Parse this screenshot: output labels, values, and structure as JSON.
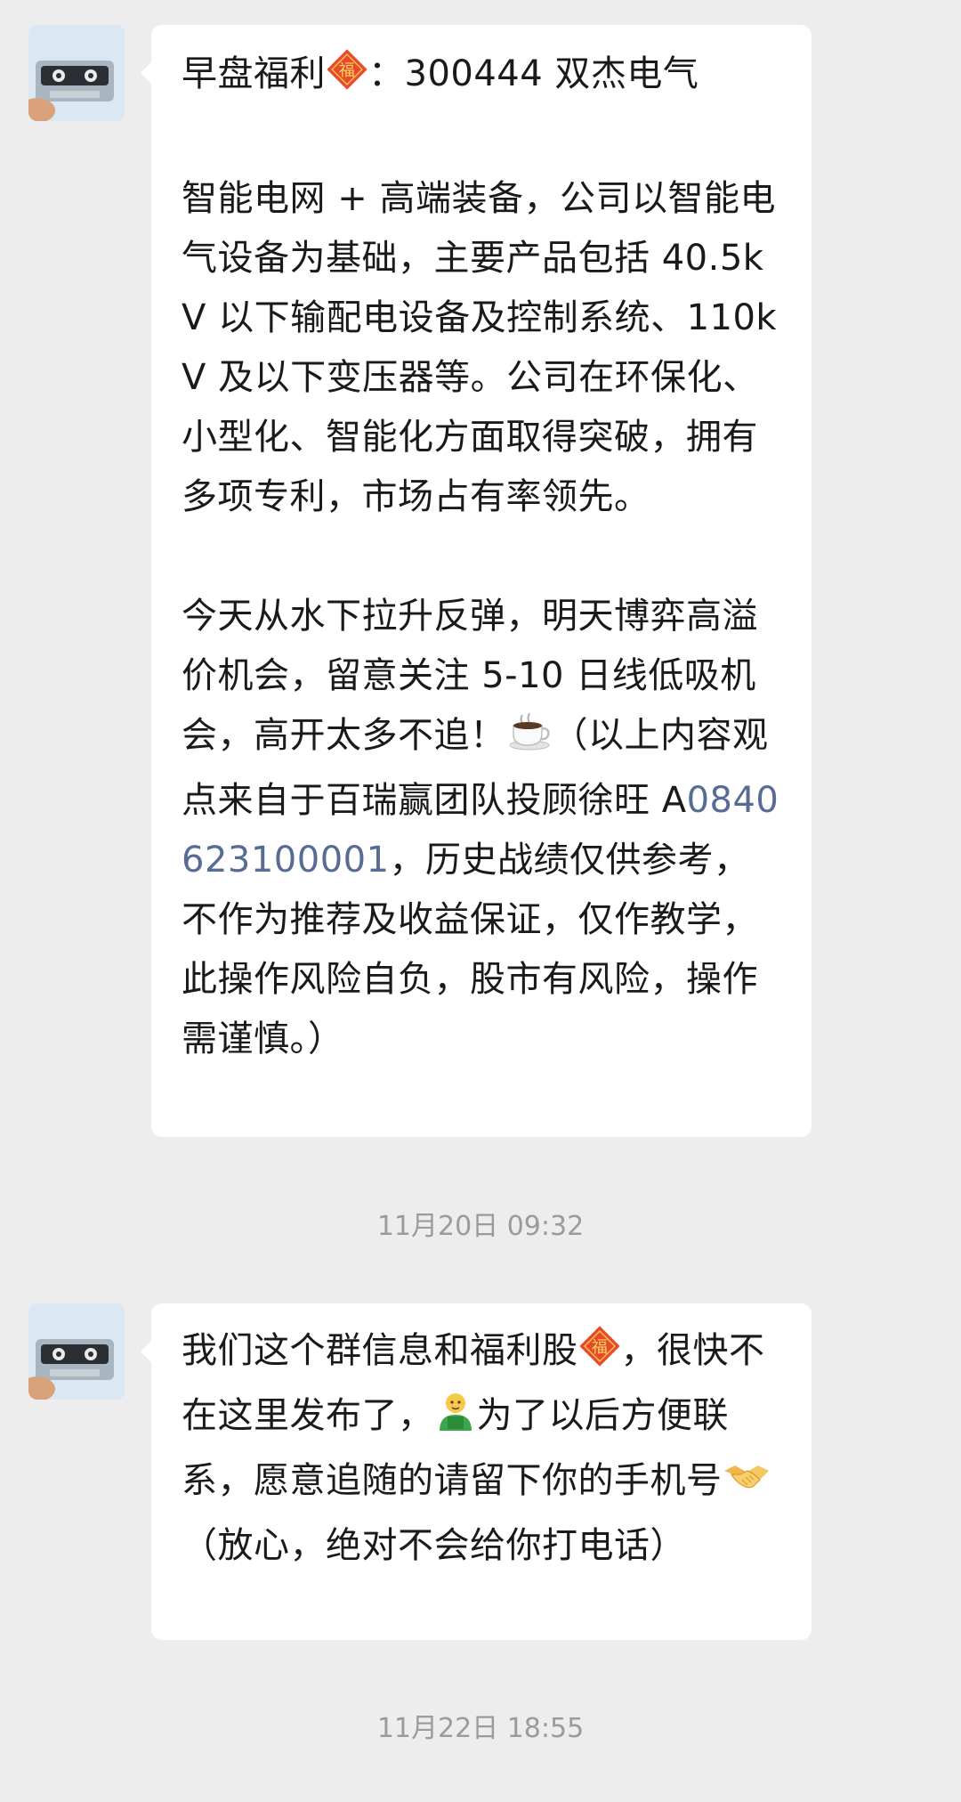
{
  "messages": [
    {
      "paragraphs": [
        [
          "早盘福利",
          "{fu}",
          "：300444 双杰电气"
        ],
        [
          "智能电网 + 高端装备，公司以智能电气设备为基础，主要产品包括 40.5kV 以下输配电设备及控制系统、110kV 及以下变压器等。公司在环保化、小型化、智能化方面取得突破，拥有多项专利，市场占有率领先。"
        ],
        [
          "今天从水下拉升反弹，明天博弈高溢价机会，留意关注 5-10 日线低吸机会，高开太多不追！",
          "{coffee}",
          "（以上内容观点来自于百瑞赢团队投顾徐旺 A",
          "{link}",
          "，历史战绩仅供参考，不作为推荐及收益保证，仅作教学，此操作风险自负，股市有风险，操作需谨慎。）"
        ]
      ],
      "link_text": "0840623100001"
    },
    {
      "paragraphs": [
        [
          "我们这个群信息和福利股",
          "{fu}",
          "，很快不在这里发布了，",
          "{person}",
          "为了以后方便联系，愿意追随的请留下你的手机号",
          "{handshake}",
          "（放心，绝对不会给你打电话）"
        ]
      ]
    }
  ],
  "timestamps": [
    "11月20日 09:32",
    "11月22日 18:55"
  ],
  "icons": {
    "fu": "fu-envelope-icon",
    "coffee": "coffee-cup-icon",
    "person": "person-icon",
    "handshake": "handshake-icon",
    "avatar": "cassette-tape-avatar"
  },
  "colors": {
    "background": "#ededed",
    "bubble": "#ffffff",
    "link": "#576b95",
    "timestamp": "#9b9b9b",
    "text": "#1a1a1a"
  }
}
